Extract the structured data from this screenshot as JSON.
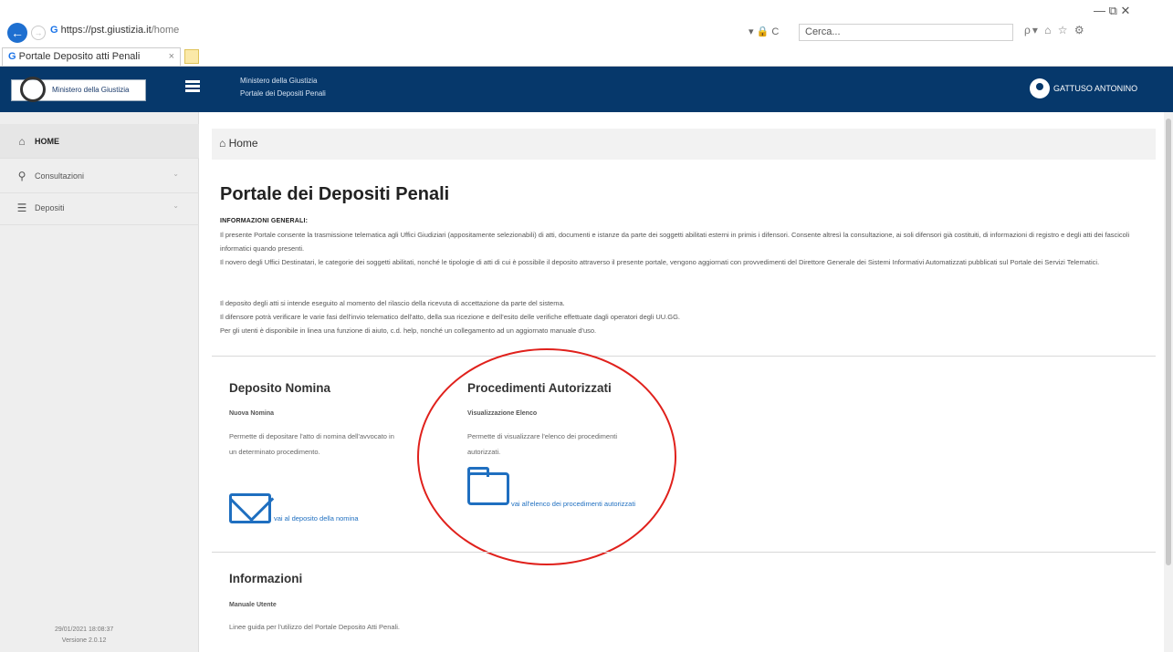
{
  "browser": {
    "url_prefix": "https://",
    "url_domain": "pst.giustizia.it",
    "url_path": "/home",
    "address_actions": "▾ 🔒 C",
    "search_placeholder": "Cerca...",
    "tab_title": "Portale Deposito atti Penali",
    "tab_close": "× ",
    "window_controls": "—   ⧉   ✕",
    "right_icons": "ρ▾ ⌂ ☆ ⚙"
  },
  "header": {
    "logo_text": "Ministero della Giustizia",
    "subtitle_line1": "Ministero della Giustizia",
    "subtitle_line2": "Portale dei Depositi Penali",
    "user_name": "GATTUSO ANTONINO"
  },
  "sidebar": {
    "items": [
      {
        "label": "HOME",
        "icon": "home-icon"
      },
      {
        "label": "Consultazioni",
        "icon": "search-icon"
      },
      {
        "label": "Depositi",
        "icon": "depositi-icon"
      }
    ],
    "footer_date": "29/01/2021 18:08:37",
    "footer_version": "Versione 2.0.12"
  },
  "breadcrumb": {
    "label": "Home"
  },
  "main": {
    "title": "Portale dei Depositi Penali",
    "info_heading": "INFORMAZIONI GENERALI:",
    "paragraphs": [
      "Il presente Portale consente la trasmissione telematica agli Uffici Giudiziari (appositamente selezionabili) di atti, documenti e istanze da parte dei soggetti abilitati esterni in primis i difensori. Consente altresì la consultazione, ai soli difensori già costituiti, di informazioni di registro e degli atti dei fascicoli informatici quando presenti.",
      "Il novero degli Uffici Destinatari, le categorie dei soggetti abilitati, nonché le tipologie di atti di cui è possibile il deposito attraverso il presente portale, vengono aggiornati con provvedimenti del Direttore Generale dei Sistemi Informativi Automatizzati pubblicati sul Portale dei Servizi Telematici.",
      "Il deposito degli atti si intende eseguito al momento del rilascio della ricevuta di accettazione da parte del sistema.",
      "Il difensore potrà verificare le varie fasi dell'invio telematico dell'atto, della sua ricezione e dell'esito delle verifiche effettuate dagli operatori degli UU.GG.",
      "Per gli utenti è disponibile in linea una funzione di aiuto, c.d. help, nonché un collegamento ad un aggiornato manuale d'uso."
    ],
    "cards": {
      "nomina": {
        "title": "Deposito Nomina",
        "subtitle": "Nuova Nomina",
        "description": "Permette di depositare l'atto di nomina dell'avvocato in un determinato procedimento.",
        "link": "vai al deposito della nomina"
      },
      "procedimenti": {
        "title": "Procedimenti Autorizzati",
        "subtitle": "Visualizzazione Elenco",
        "description": "Permette di visualizzare l'elenco dei procedimenti autorizzati.",
        "link": "vai all'elenco dei procedimenti autorizzati"
      },
      "informazioni": {
        "title": "Informazioni",
        "subtitle": "Manuale Utente",
        "description": "Linee guida per l'utilizzo del Portale Deposito Atti Penali."
      }
    }
  },
  "colors": {
    "header_bg": "#06386b",
    "link": "#1f6fc0",
    "annotation_circle": "#e0211c"
  }
}
